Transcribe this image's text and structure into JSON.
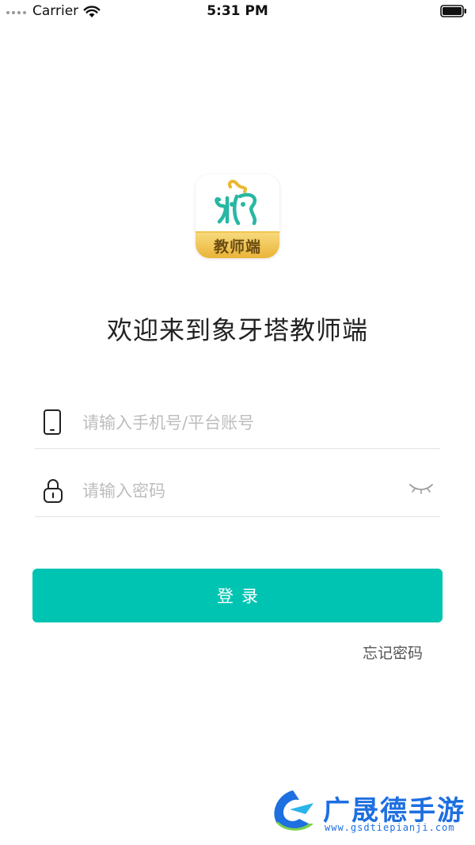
{
  "status_bar": {
    "carrier": "Carrier",
    "time": "5:31 PM"
  },
  "app_logo": {
    "badge_text": "教师端"
  },
  "welcome": {
    "title": "欢迎来到象牙塔教师端"
  },
  "phone_field": {
    "placeholder": "请输入手机号/平台账号",
    "value": ""
  },
  "password_field": {
    "placeholder": "请输入密码",
    "value": ""
  },
  "login": {
    "label": "登录"
  },
  "forgot_password": {
    "label": "忘记密码"
  },
  "watermark": {
    "text": "广晟德手游",
    "url": "www.gsdtiepianji.com"
  },
  "colors": {
    "accent": "#00c4b2",
    "logo_badge": "#eab437",
    "watermark": "#1e6fe0"
  },
  "icons": [
    "wifi-icon",
    "battery-icon",
    "phone-icon",
    "lock-icon",
    "eye-closed-icon"
  ]
}
